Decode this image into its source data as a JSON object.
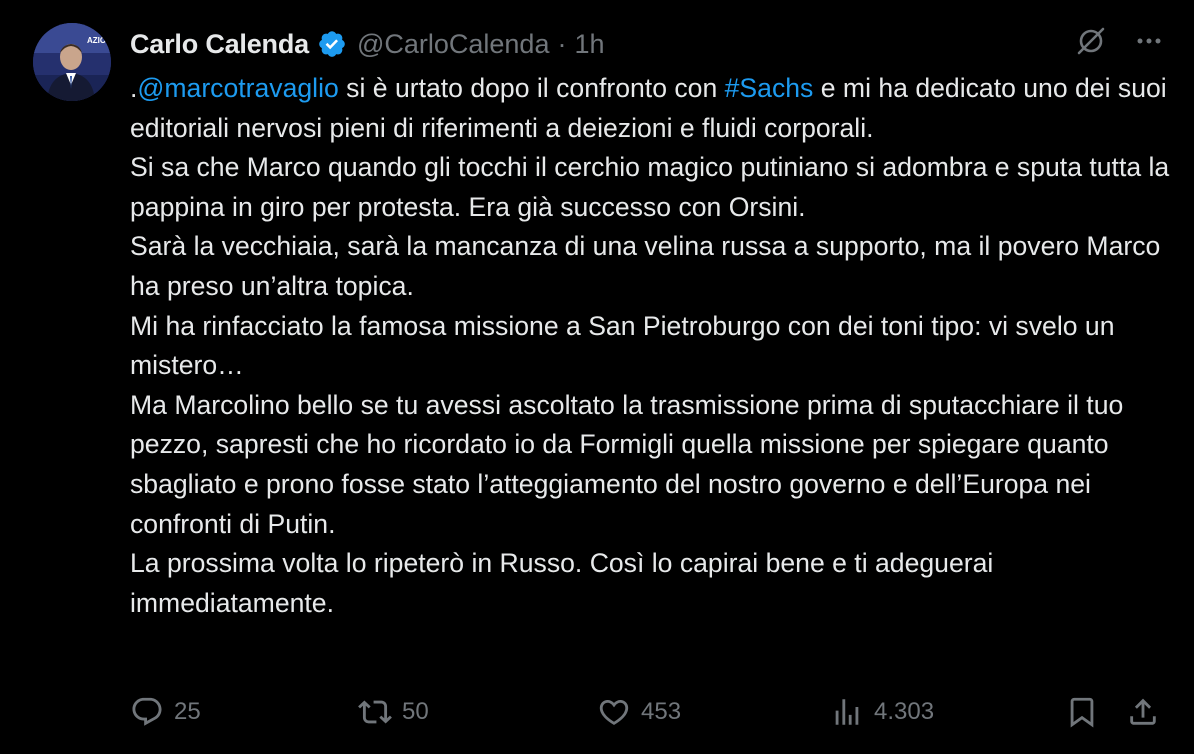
{
  "author": {
    "display_name": "Carlo Calenda",
    "handle": "@CarloCalenda",
    "separator": "·",
    "time": "1h",
    "avatar_text": "AZIONE"
  },
  "colors": {
    "background": "#000000",
    "text": "#e7e9ea",
    "secondary": "#71767b",
    "link": "#1d9bf0",
    "verified": "#1d9bf0"
  },
  "icons": {
    "verified": "verified-badge-icon",
    "grok": "grok-icon",
    "more": "more-icon",
    "reply": "reply-icon",
    "repost": "repost-icon",
    "like": "like-icon",
    "views": "views-icon",
    "bookmark": "bookmark-icon",
    "share": "share-icon"
  },
  "tweet": {
    "p1_prefix": ".",
    "mention": "@marcotravaglio",
    "p1_mid": " si è urtato dopo il confronto con ",
    "hashtag": "#Sachs",
    "p1_suffix": " e mi ha dedicato uno dei suoi editoriali nervosi pieni di riferimenti a deiezioni e fluidi corporali.",
    "p2": "Si sa che Marco quando gli tocchi il cerchio magico putiniano si adombra e sputa tutta la pappina in giro per protesta. Era già successo con Orsini.",
    "p3": "Sarà la vecchiaia, sarà la mancanza di una velina russa a supporto, ma il povero Marco ha preso un’altra topica.",
    "p4": "Mi ha rinfacciato la famosa missione a San Pietroburgo con dei toni tipo: vi svelo un mistero…",
    "p5": "Ma Marcolino bello se tu avessi ascoltato la trasmissione prima di sputacchiare il tuo pezzo, sapresti che ho ricordato io da Formigli quella missione per spiegare quanto sbagliato e prono fosse stato l’atteggiamento del nostro governo e dell’Europa nei confronti di Putin.",
    "p6": "La prossima volta lo ripeterò in Russo. Così lo capirai bene e ti adeguerai immediatamente."
  },
  "actions": {
    "replies": "25",
    "reposts": "50",
    "likes": "453",
    "views": "4.303"
  }
}
